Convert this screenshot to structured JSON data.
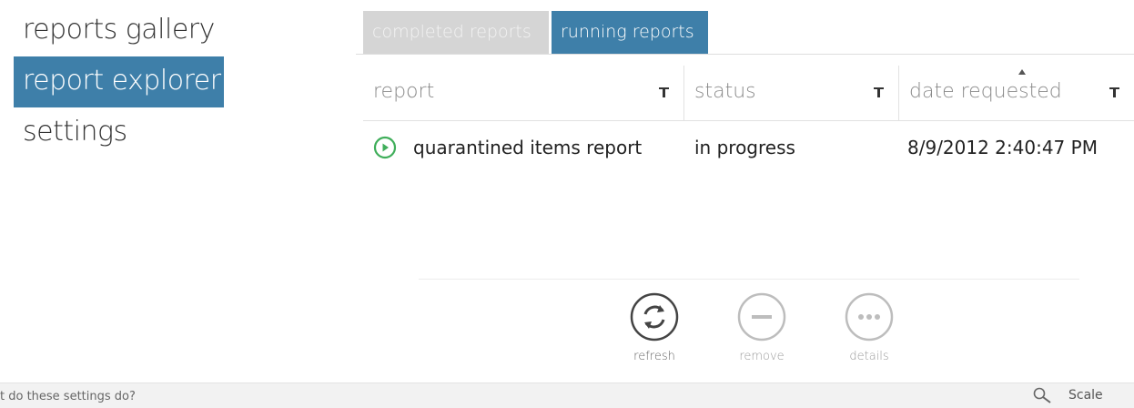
{
  "nav": {
    "items": [
      {
        "label": "reports gallery"
      },
      {
        "label": "report explorer"
      },
      {
        "label": "settings"
      }
    ]
  },
  "tabs": [
    {
      "label": "completed reports",
      "active": false
    },
    {
      "label": "running reports",
      "active": true
    }
  ],
  "table": {
    "columns": [
      {
        "label": "report"
      },
      {
        "label": "status"
      },
      {
        "label": "date requested",
        "sorted": "ascending"
      }
    ],
    "rows": [
      {
        "report": "quarantined items report",
        "status": "in progress",
        "date_requested": "8/9/2012 2:40:47 PM"
      }
    ]
  },
  "actions": {
    "refresh": "refresh",
    "remove": "remove",
    "details": "details"
  },
  "statusbar": {
    "help_text": "t do these settings do?",
    "scale_label": "Scale"
  },
  "colors": {
    "accent": "#3e7fa9",
    "running_icon": "#3fae5a",
    "inactive_tab": "#d5d5d5"
  }
}
